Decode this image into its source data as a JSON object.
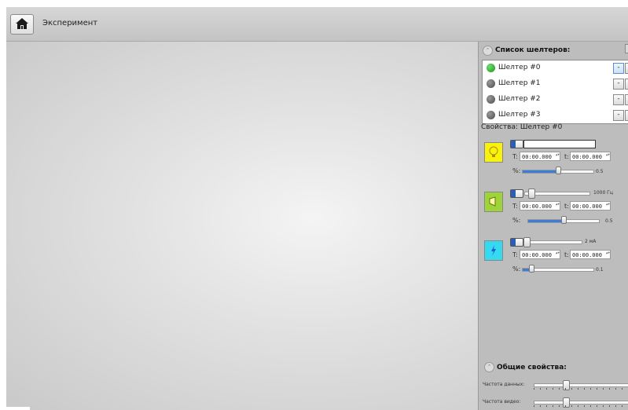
{
  "app": {
    "title": "Эксперимент"
  },
  "shelters": {
    "title": "Список шелтеров:",
    "items": [
      {
        "label": "Шелтер #0",
        "status": "green",
        "minus": "-"
      },
      {
        "label": "Шелтер #1",
        "status": "gray",
        "minus": "-"
      },
      {
        "label": "Шелтер #2",
        "status": "gray",
        "minus": "-"
      },
      {
        "label": "Шелтер #3",
        "status": "gray",
        "minus": "-"
      }
    ]
  },
  "properties": {
    "label": "Свойства: Шелтер #0",
    "effects": [
      {
        "name": "light",
        "icon": "light-bulb-icon",
        "color": "#f7f20e",
        "t_label": "T:",
        "t_value": "00:00.000",
        "t2_label": "t:",
        "t2_value": "00:00.000",
        "percent_label": "%:",
        "percent_value": "0.5",
        "percent_level": 0.5
      },
      {
        "name": "sound",
        "icon": "horn-icon",
        "color": "#9ed43a",
        "slider_value": "1000 Гц",
        "slider_level": 0.05,
        "t_label": "T:",
        "t_value": "00:00.000",
        "t2_label": "t:",
        "t2_value": "00:00.000",
        "percent_label": "%:",
        "percent_value": "0.5",
        "percent_level": 0.5
      },
      {
        "name": "shock",
        "icon": "lightning-icon",
        "color": "#35d9f0",
        "slider_value": "2 мА",
        "slider_level": 0.02,
        "t_label": "T:",
        "t_value": "00:00.000",
        "t2_label": "t:",
        "t2_value": "00:00.000",
        "percent_label": "%:",
        "percent_value": "0.1",
        "percent_level": 0.1
      }
    ]
  },
  "general": {
    "title": "Общие свойства:",
    "data_rate_label": "Частота данных:",
    "video_rate_label": "Частота видео:"
  }
}
